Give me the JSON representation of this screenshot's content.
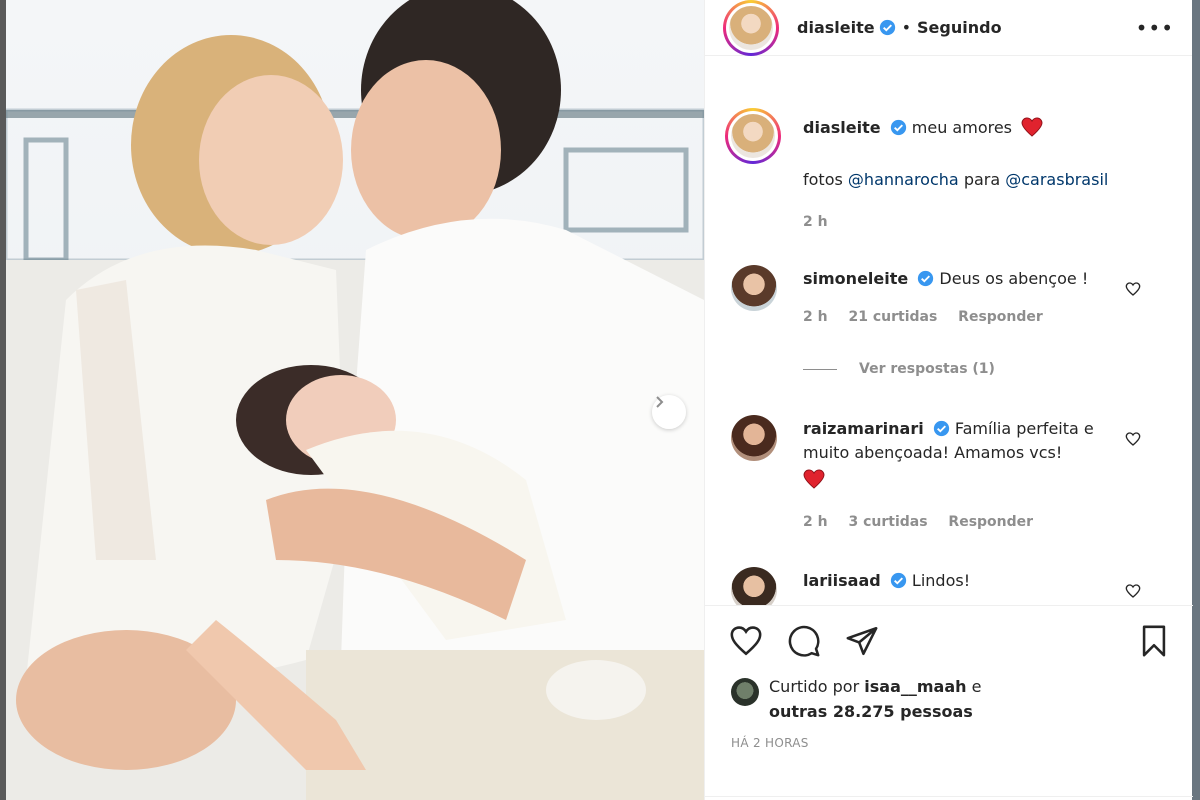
{
  "post": {
    "username": "diasleite",
    "separator": "•",
    "follow_status": "Seguindo",
    "more_label": "•••"
  },
  "caption": {
    "username": "diasleite",
    "text": "meu amores",
    "credits_prefix": "fotos",
    "mention1": "@hannarocha",
    "credits_middle": "para",
    "mention2": "@carasbrasil",
    "time": "2 h"
  },
  "comments": [
    {
      "username": "simoneleite",
      "text": "Deus os abençoe !",
      "time": "2 h",
      "likes": "21 curtidas",
      "reply": "Responder"
    },
    {
      "username": "raizamarinari",
      "text": "Família perfeita e muito abençoada! Amamos vcs!",
      "time": "2 h",
      "likes": "3 curtidas",
      "reply": "Responder"
    },
    {
      "username": "lariisaad",
      "text": "Lindos!"
    }
  ],
  "view_replies": "Ver respostas (1)",
  "likes": {
    "prefix": "Curtido por",
    "user": "isaa__maah",
    "conj": "e",
    "others": "outras 28.275 pessoas"
  },
  "posted_ago": "HÁ 2 HORAS",
  "colors": {
    "verified": "#3897f0",
    "heart": "#ed4956",
    "mention": "#00376b",
    "muted": "#8e8e8e"
  }
}
